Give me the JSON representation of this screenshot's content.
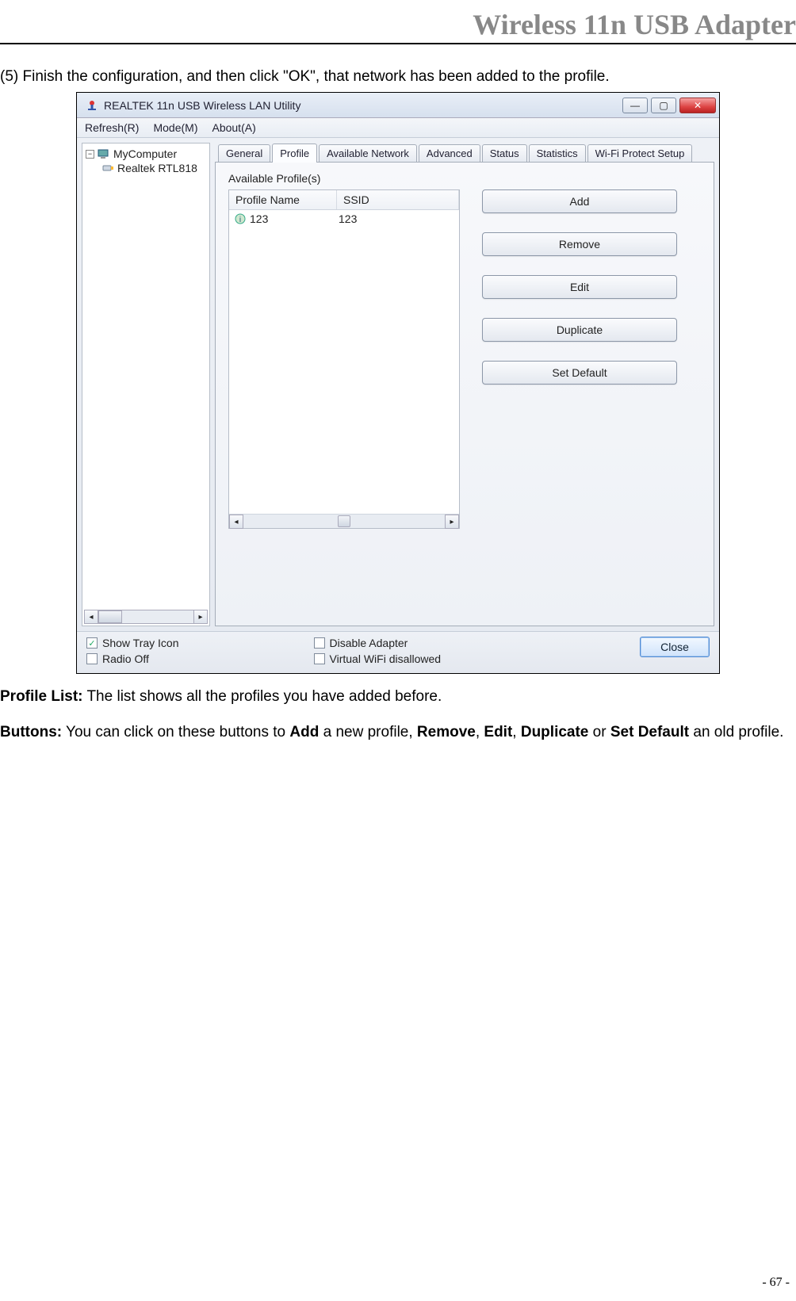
{
  "header": {
    "title": "Wireless 11n USB Adapter"
  },
  "instruction": "(5) Finish the configuration, and then click \"OK\", that network has been added to the profile.",
  "window": {
    "title": "REALTEK 11n USB Wireless LAN Utility",
    "menu": {
      "refresh": "Refresh(R)",
      "mode": "Mode(M)",
      "about": "About(A)"
    },
    "tree": {
      "root": "MyComputer",
      "child": "Realtek RTL818"
    },
    "tabs": {
      "general": "General",
      "profile": "Profile",
      "available_network": "Available Network",
      "advanced": "Advanced",
      "status": "Status",
      "statistics": "Statistics",
      "wps": "Wi-Fi Protect Setup"
    },
    "profile_section_label": "Available Profile(s)",
    "profile_list": {
      "col_profile_name": "Profile Name",
      "col_ssid": "SSID",
      "rows": [
        {
          "name": "123",
          "ssid": "123"
        }
      ]
    },
    "buttons": {
      "add": "Add",
      "remove": "Remove",
      "edit": "Edit",
      "duplicate": "Duplicate",
      "set_default": "Set Default"
    },
    "bottom": {
      "show_tray_icon": "Show Tray Icon",
      "radio_off": "Radio Off",
      "disable_adapter": "Disable Adapter",
      "virtual_wifi_disallowed": "Virtual WiFi disallowed",
      "close": "Close"
    }
  },
  "body": {
    "profile_list_label": "Profile List:",
    "profile_list_text": " The list shows all the profiles you have added before.",
    "buttons_label": "Buttons:",
    "buttons_pre": " You can click on these buttons to ",
    "add": "Add",
    "buttons_mid1": " a new profile, ",
    "remove": "Remove",
    "comma1": ", ",
    "edit": "Edit",
    "comma2": ", ",
    "duplicate": "Duplicate",
    "or": " or ",
    "set_default": "Set Default",
    "buttons_post": " an old profile."
  },
  "page_number": "- 67 -"
}
